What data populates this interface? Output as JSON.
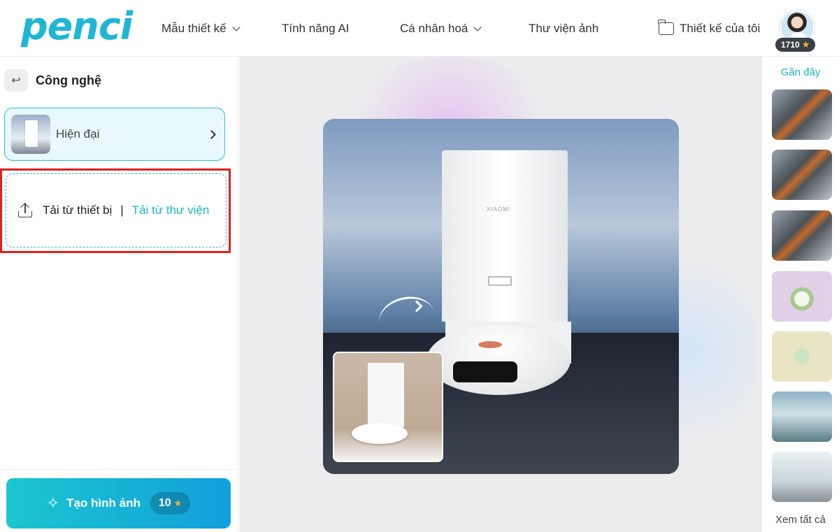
{
  "brand": {
    "logo": "penci",
    "color": "#1fb6d6"
  },
  "nav": {
    "templates": "Mẫu thiết kế",
    "ai_features": "Tính năng AI",
    "personalize": "Cá nhân hoá",
    "gallery": "Thư viện ảnh",
    "my_designs": "Thiết kế của tôi"
  },
  "user": {
    "credits": "1710",
    "credit_icon": "star-icon"
  },
  "left_panel": {
    "back_icon": "back-arrow-icon",
    "title": "Công nghệ",
    "style_card": {
      "label": "Hiện đại"
    },
    "upload": {
      "device_label": "Tải từ thiết bị",
      "separator": "|",
      "library_label": "Tải từ thư viện"
    },
    "create_button": {
      "label": "Tạo hình ảnh",
      "cost": "10"
    }
  },
  "canvas": {
    "preview_brand_text": "XIAOMI"
  },
  "right_panel": {
    "title": "Gần đây",
    "see_all": "Xem tất cả",
    "thumbnails": [
      "robot-art",
      "robot-art",
      "robot-art",
      "drink",
      "drink",
      "drink",
      "laptop"
    ]
  },
  "colors": {
    "accent": "#1db5c9",
    "highlight_border": "#e02020",
    "button_gradient_start": "#1bc6cf",
    "button_gradient_end": "#129fdc"
  }
}
